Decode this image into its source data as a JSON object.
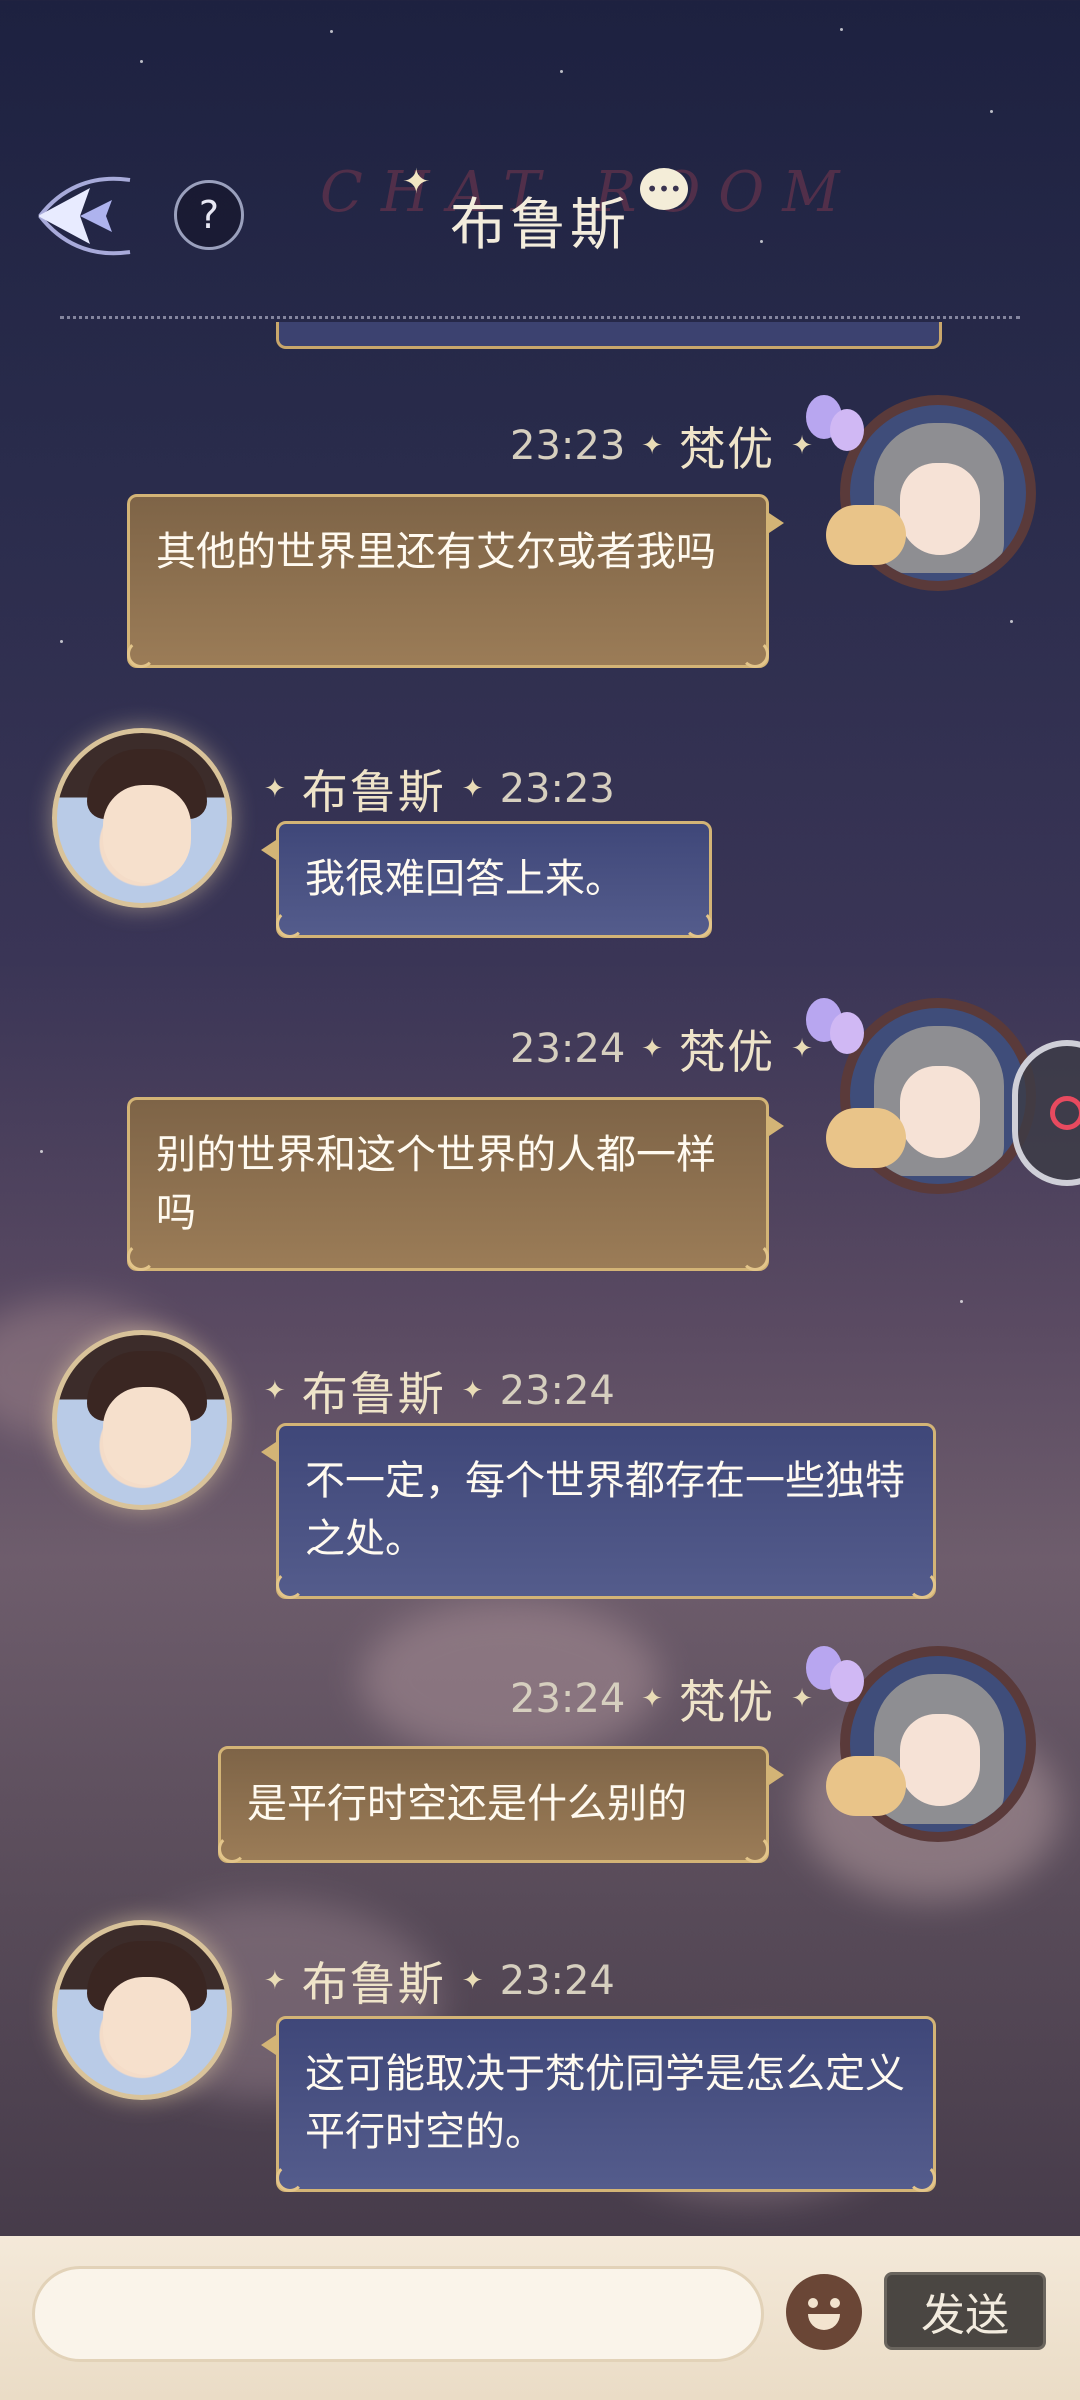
{
  "header": {
    "bg_title": "CHAT ROOM",
    "title": "布鲁斯",
    "help_label": "?"
  },
  "messages": [
    {
      "sender": "梵优",
      "time": "23:23",
      "text": "其他的世界里还有艾尔或者我吗",
      "direction": "outgoing"
    },
    {
      "sender": "布鲁斯",
      "time": "23:23",
      "text": "我很难回答上来。",
      "direction": "incoming"
    },
    {
      "sender": "梵优",
      "time": "23:24",
      "text": "别的世界和这个世界的人都一样吗",
      "direction": "outgoing"
    },
    {
      "sender": "布鲁斯",
      "time": "23:24",
      "text": "不一定，每个世界都存在一些独特之处。",
      "direction": "incoming"
    },
    {
      "sender": "梵优",
      "time": "23:24",
      "text": "是平行时空还是什么别的",
      "direction": "outgoing"
    },
    {
      "sender": "布鲁斯",
      "time": "23:24",
      "text": "这可能取决于梵优同学是怎么定义平行时空的。",
      "direction": "incoming"
    }
  ],
  "input": {
    "value": "",
    "placeholder": ""
  },
  "send_label": "发送",
  "icons": {
    "back": "back-arrow-icon",
    "help": "question-icon",
    "chat": "chat-bubble-icon",
    "emoji": "emoji-icon",
    "floating": "recorder-icon"
  },
  "colors": {
    "outgoing_bubble": "#8a6e4d",
    "incoming_bubble": "#4a5282",
    "bubble_border": "#d3b476",
    "send_button": "#4a4642"
  }
}
